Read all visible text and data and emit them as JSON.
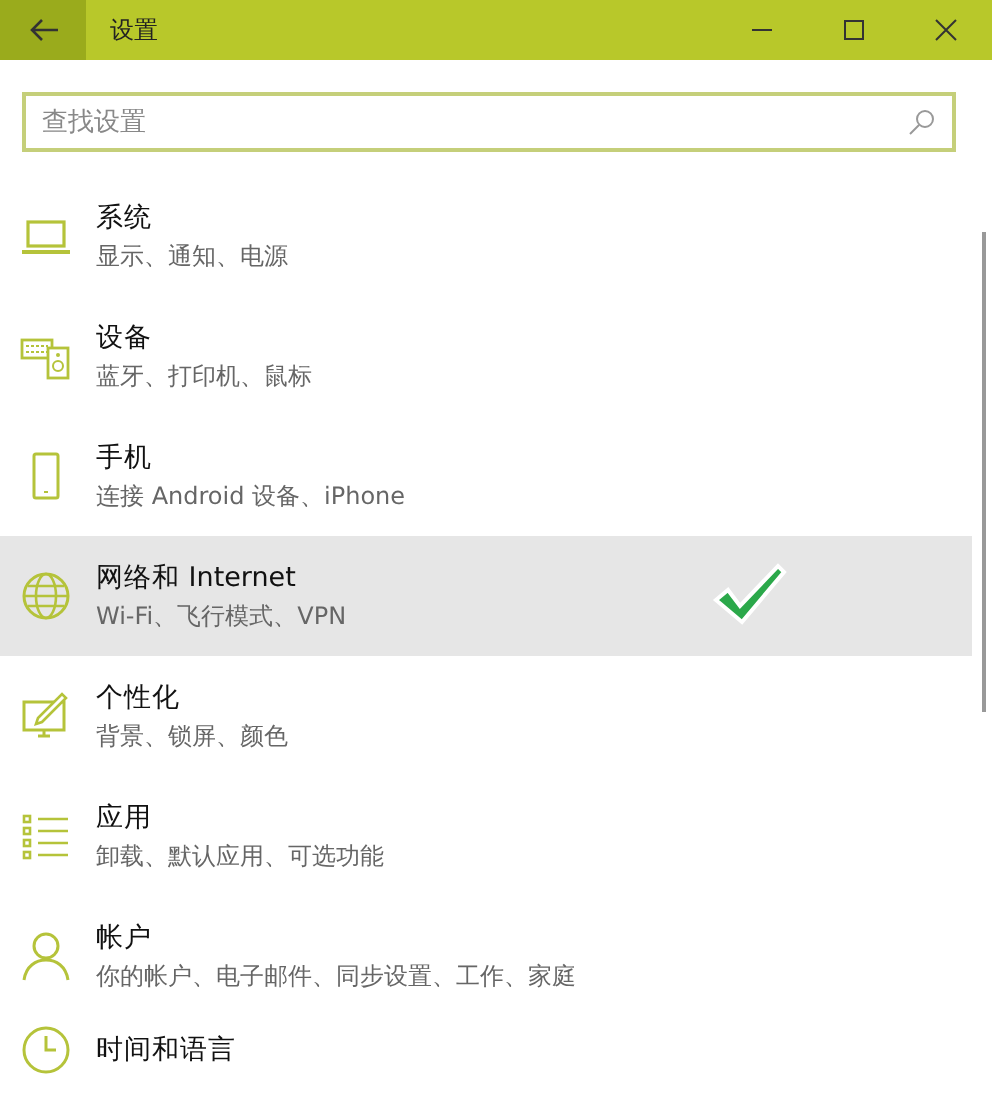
{
  "window": {
    "title": "设置"
  },
  "search": {
    "placeholder": "查找设置"
  },
  "items": [
    {
      "kind": "laptop",
      "title": "系统",
      "subtitle": "显示、通知、电源",
      "selected": false
    },
    {
      "kind": "devices",
      "title": "设备",
      "subtitle": "蓝牙、打印机、鼠标",
      "selected": false
    },
    {
      "kind": "phone",
      "title": "手机",
      "subtitle": "连接 Android 设备、iPhone",
      "selected": false
    },
    {
      "kind": "globe",
      "title": "网络和 Internet",
      "subtitle": "Wi-Fi、飞行模式、VPN",
      "selected": true
    },
    {
      "kind": "personalize",
      "title": "个性化",
      "subtitle": "背景、锁屏、颜色",
      "selected": false
    },
    {
      "kind": "apps",
      "title": "应用",
      "subtitle": "卸载、默认应用、可选功能",
      "selected": false
    },
    {
      "kind": "person",
      "title": "帐户",
      "subtitle": "你的帐户、电子邮件、同步设置、工作、家庭",
      "selected": false
    },
    {
      "kind": "clock",
      "title": "时间和语言",
      "selected": false
    }
  ]
}
